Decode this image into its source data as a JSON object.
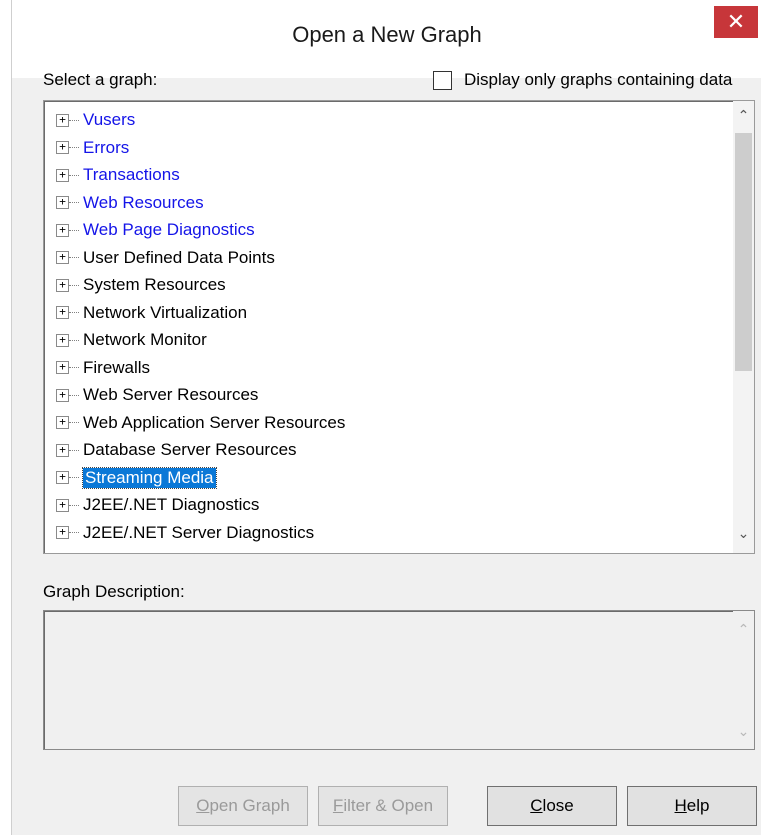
{
  "window": {
    "title": "Open a New Graph",
    "close_glyph": "✕"
  },
  "select_label": "Select a graph:",
  "display_only": {
    "label": "Display only graphs containing data",
    "checked": false
  },
  "tree": {
    "expander_glyph": "+",
    "items": [
      {
        "label": "Vusers"
      },
      {
        "label": "Errors"
      },
      {
        "label": "Transactions"
      },
      {
        "label": "Web Resources"
      },
      {
        "label": "Web Page Diagnostics"
      },
      {
        "label": "User Defined Data Points"
      },
      {
        "label": "System Resources"
      },
      {
        "label": "Network Virtualization"
      },
      {
        "label": "Network Monitor"
      },
      {
        "label": "Firewalls"
      },
      {
        "label": "Web Server Resources"
      },
      {
        "label": "Web Application Server Resources"
      },
      {
        "label": "Database Server Resources"
      },
      {
        "label": "Streaming Media"
      },
      {
        "label": "J2EE/.NET Diagnostics"
      },
      {
        "label": "J2EE/.NET Server Diagnostics"
      }
    ],
    "selected": "Streaming Media",
    "colors": {
      "link_blue": "#1414e8",
      "selected_bg": "#0a78d7"
    }
  },
  "description_label": "Graph Description:",
  "buttons": {
    "open_graph": {
      "first": "O",
      "rest": "pen Graph",
      "enabled": false
    },
    "filter_open": {
      "first": "F",
      "rest": "ilter & Open",
      "enabled": false
    },
    "close": {
      "first": "C",
      "rest": "lose",
      "enabled": true
    },
    "help": {
      "first": "H",
      "rest": "elp",
      "enabled": true
    }
  },
  "scroll_up_glyph": "⌃",
  "scroll_down_glyph": "⌄"
}
